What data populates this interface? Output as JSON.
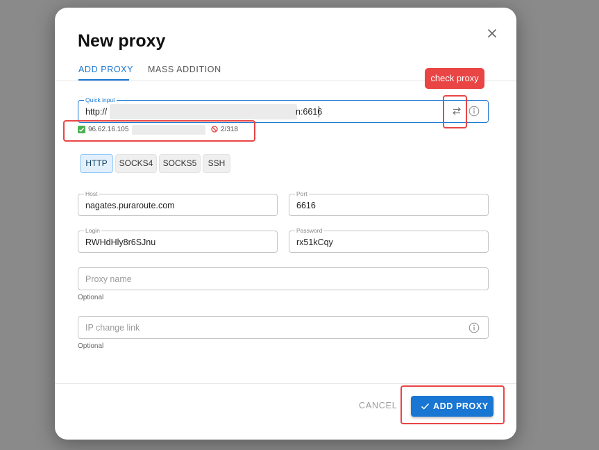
{
  "dialog": {
    "title": "New proxy",
    "tabs": [
      {
        "label": "ADD PROXY",
        "active": true
      },
      {
        "label": "MASS ADDITION",
        "active": false
      }
    ]
  },
  "quick_input": {
    "label": "Quick input",
    "value_prefix": "http://",
    "value_suffix": "n:6616"
  },
  "check_status": {
    "ip": "96.62.16.105",
    "count": "2/318"
  },
  "protocols": [
    {
      "label": "HTTP",
      "selected": true
    },
    {
      "label": "SOCKS4",
      "selected": false
    },
    {
      "label": "SOCKS5",
      "selected": false
    },
    {
      "label": "SSH",
      "selected": false
    }
  ],
  "fields": {
    "host": {
      "label": "Host",
      "value": "nagates.puraroute.com"
    },
    "port": {
      "label": "Port",
      "value": "6616"
    },
    "login": {
      "label": "Login",
      "value": "RWHdHly8r6SJnu"
    },
    "password": {
      "label": "Password",
      "value": "rx51kCqy"
    },
    "proxy_name": {
      "placeholder": "Proxy name",
      "helper": "Optional"
    },
    "ip_change_link": {
      "placeholder": "IP change link",
      "helper": "Optional"
    }
  },
  "footer": {
    "cancel_label": "CANCEL",
    "add_label": "ADD PROXY"
  },
  "annotation": {
    "callout_text": "check proxy"
  },
  "colors": {
    "primary": "#1976d2",
    "annotation": "#e94545",
    "success": "#4caf50",
    "danger": "#e53935"
  }
}
